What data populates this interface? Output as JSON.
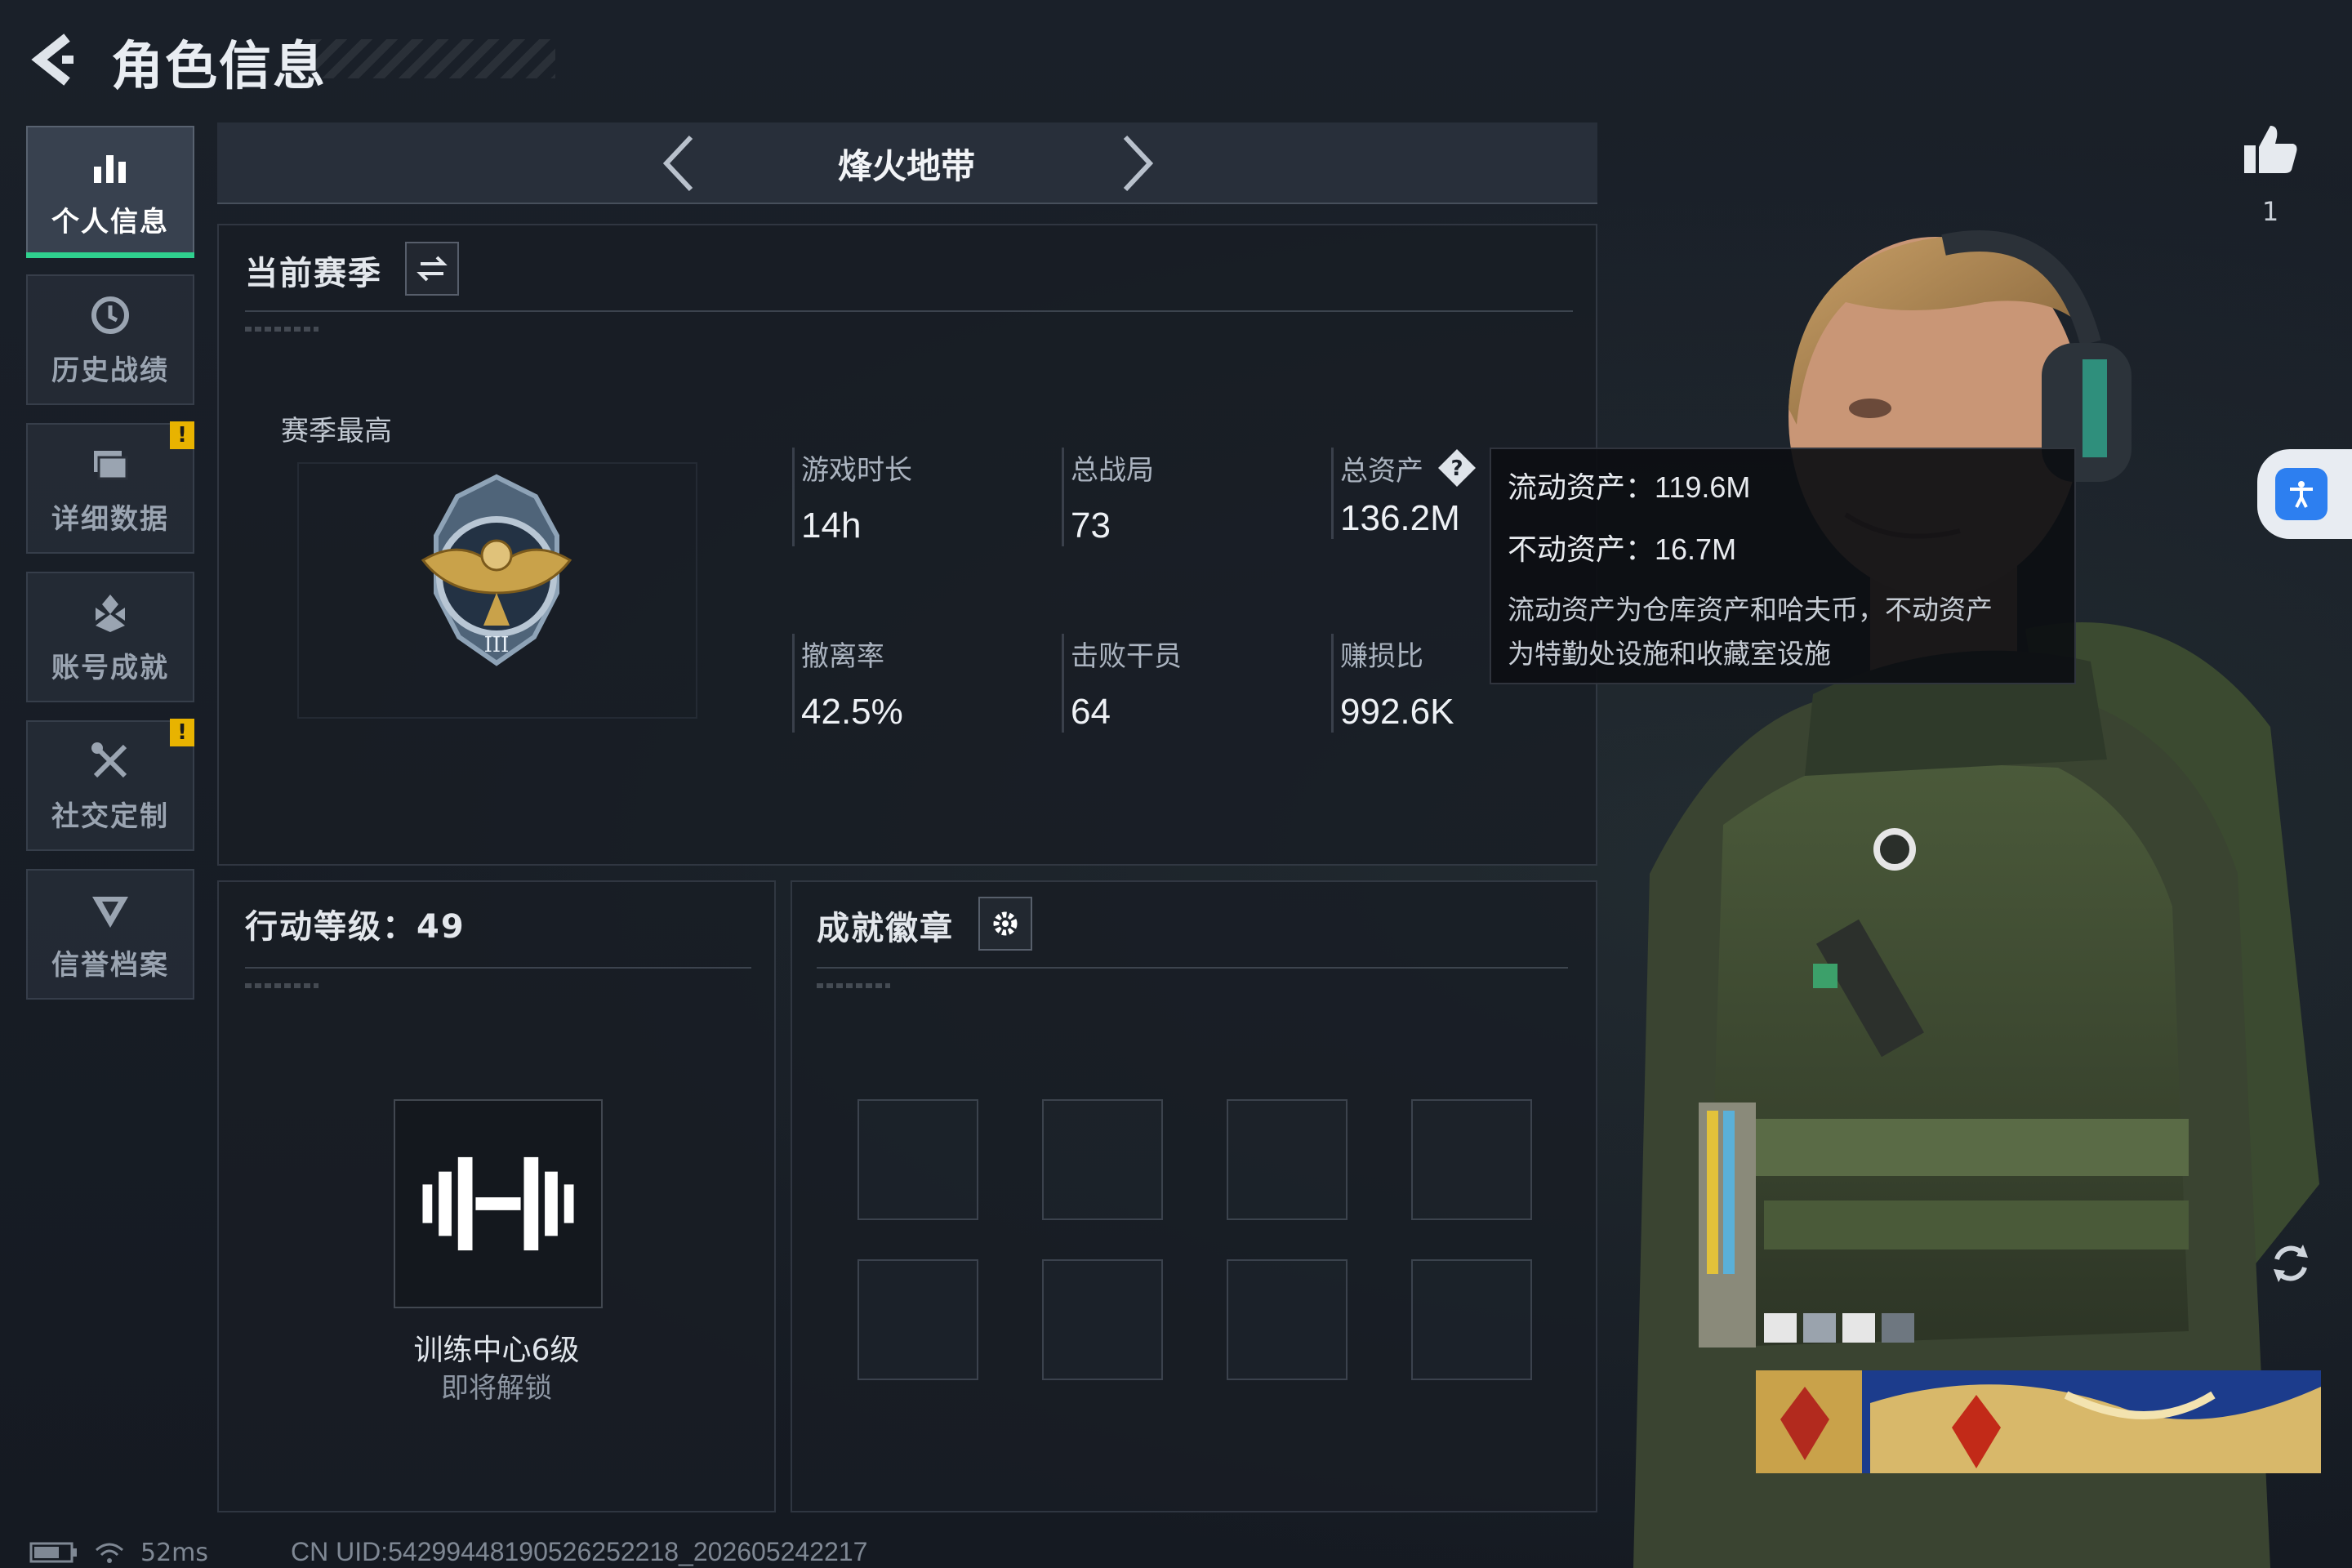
{
  "header": {
    "title": "角色信息"
  },
  "sidebar": {
    "items": [
      {
        "label": "个人信息",
        "active": true,
        "alert": ""
      },
      {
        "label": "历史战绩",
        "active": false,
        "alert": ""
      },
      {
        "label": "详细数据",
        "active": false,
        "alert": "!"
      },
      {
        "label": "账号成就",
        "active": false,
        "alert": ""
      },
      {
        "label": "社交定制",
        "active": false,
        "alert": "!"
      },
      {
        "label": "信誉档案",
        "active": false,
        "alert": ""
      }
    ]
  },
  "mode": {
    "title": "烽火地带"
  },
  "season": {
    "title": "当前赛季",
    "best_label": "赛季最高",
    "stats": [
      {
        "label": "游戏时长",
        "value": "14h"
      },
      {
        "label": "总战局",
        "value": "73"
      },
      {
        "label": "总资产",
        "value": "136.2M"
      },
      {
        "label": "撤离率",
        "value": "42.5%"
      },
      {
        "label": "击败干员",
        "value": "64"
      },
      {
        "label": "赚损比",
        "value": "992.6K"
      }
    ]
  },
  "tooltip": {
    "liquid": "流动资产：119.6M",
    "fixed": "不动资产：16.7M",
    "desc_line1": "流动资产为仓库资产和哈夫币，不动资产",
    "desc_line2": "为特勤处设施和收藏室设施"
  },
  "level": {
    "title": "行动等级：49",
    "unlock_name": "训练中心6级",
    "unlock_status": "即将解锁"
  },
  "badges": {
    "title": "成就徽章",
    "slots": 8
  },
  "likes": {
    "count": "1"
  },
  "status": {
    "ping": "52ms",
    "uid": "CN UID:5429944819052625​2218_202605242217"
  },
  "colors": {
    "accent_green": "#2fd08e",
    "alert_yellow": "#e8b300",
    "access_blue": "#2d7ff0"
  }
}
